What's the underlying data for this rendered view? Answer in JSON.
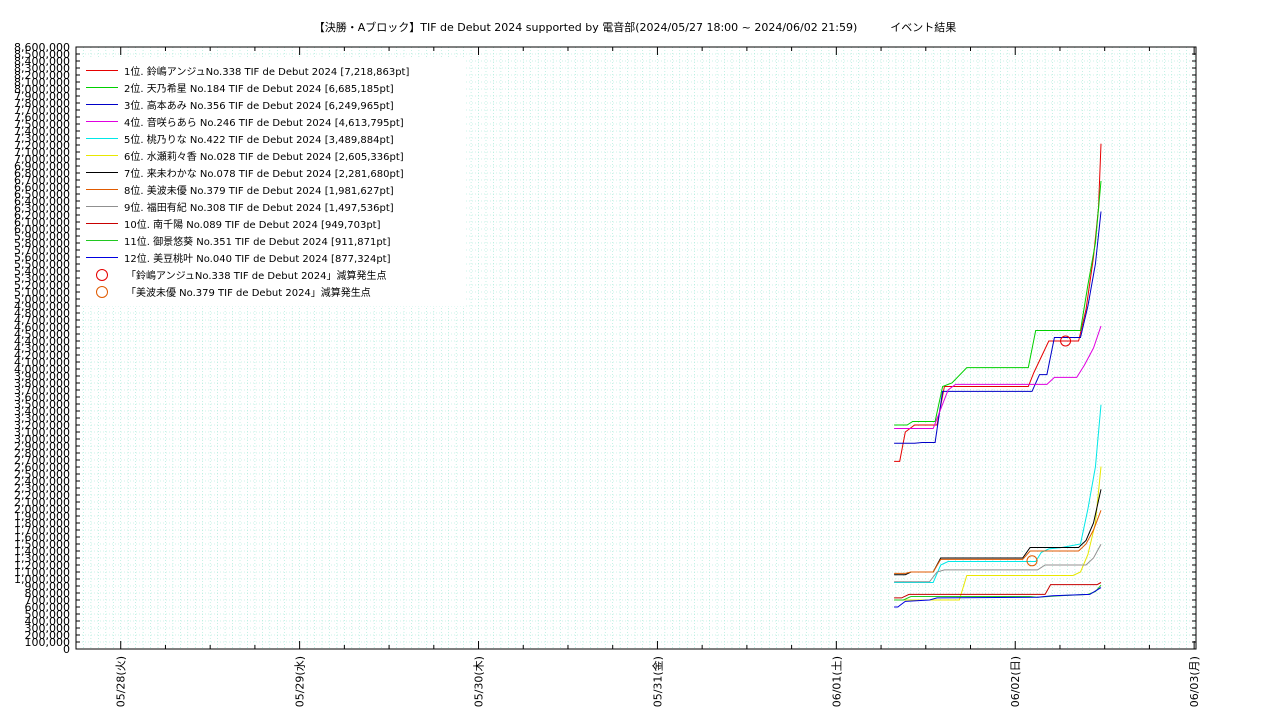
{
  "chart_data": {
    "type": "line",
    "title": "【決勝・Aブロック】TIF de Debut 2024 supported by 電音部(2024/05/27 18:00 ~ 2024/06/02 21:59)　　　イベント結果",
    "xlabel": "",
    "ylabel": "",
    "ylim": [
      0,
      8600000
    ],
    "xlim": [
      "2024-05-27 18:00",
      "2024-06-03 00:15"
    ],
    "y_tick_step": 100000,
    "x_tick_labels": [
      "05/28(火)",
      "05/29(水)",
      "05/30(木)",
      "05/31(金)",
      "06/01(土)",
      "06/02(日)",
      "06/03(月)"
    ],
    "x_tick_dates": [
      "2024-05-28 00:00",
      "2024-05-29 00:00",
      "2024-05-30 00:00",
      "2024-05-31 00:00",
      "2024-06-01 00:00",
      "2024-06-02 00:00",
      "2024-06-03 00:00"
    ],
    "grid": true,
    "legend_position": "top-left",
    "series": [
      {
        "name": "1位. 鈴嶋アンジュNo.338 TIF de Debut 2024 [7,218,863pt]",
        "color": "#e60000",
        "points": [
          [
            "2024-06-01 07:45",
            2680000
          ],
          [
            "2024-06-01 08:30",
            2680000
          ],
          [
            "2024-06-01 09:15",
            3100000
          ],
          [
            "2024-06-01 10:30",
            3200000
          ],
          [
            "2024-06-01 13:30",
            3200000
          ],
          [
            "2024-06-01 14:30",
            3750000
          ],
          [
            "2024-06-02 01:45",
            3750000
          ],
          [
            "2024-06-02 02:30",
            3950000
          ],
          [
            "2024-06-02 04:30",
            4400000
          ],
          [
            "2024-06-02 08:30",
            4400000
          ],
          [
            "2024-06-02 09:30",
            4850000
          ],
          [
            "2024-06-02 10:30",
            5600000
          ],
          [
            "2024-06-02 11:10",
            6300000
          ],
          [
            "2024-06-02 11:30",
            7218863
          ]
        ]
      },
      {
        "name": "2位. 天乃希星 No.184 TIF de Debut 2024 [6,685,185pt]",
        "color": "#00d000",
        "points": [
          [
            "2024-06-01 07:45",
            3200000
          ],
          [
            "2024-06-01 09:30",
            3200000
          ],
          [
            "2024-06-01 10:15",
            3250000
          ],
          [
            "2024-06-01 13:15",
            3250000
          ],
          [
            "2024-06-01 14:15",
            3750000
          ],
          [
            "2024-06-01 15:30",
            3800000
          ],
          [
            "2024-06-01 17:30",
            4020000
          ],
          [
            "2024-06-02 01:45",
            4020000
          ],
          [
            "2024-06-02 02:45",
            4550000
          ],
          [
            "2024-06-02 08:45",
            4550000
          ],
          [
            "2024-06-02 09:45",
            5200000
          ],
          [
            "2024-06-02 10:45",
            5800000
          ],
          [
            "2024-06-02 11:30",
            6685185
          ]
        ]
      },
      {
        "name": "3位. 高本あみ No.356 TIF de Debut 2024 [6,249,965pt]",
        "color": "#0000c8",
        "points": [
          [
            "2024-06-01 07:45",
            2940000
          ],
          [
            "2024-06-01 10:30",
            2940000
          ],
          [
            "2024-06-01 11:30",
            2950000
          ],
          [
            "2024-06-01 13:15",
            2950000
          ],
          [
            "2024-06-01 14:15",
            3680000
          ],
          [
            "2024-06-02 02:15",
            3680000
          ],
          [
            "2024-06-02 03:15",
            3920000
          ],
          [
            "2024-06-02 04:15",
            3920000
          ],
          [
            "2024-06-02 05:15",
            4450000
          ],
          [
            "2024-06-02 08:45",
            4450000
          ],
          [
            "2024-06-02 09:45",
            4900000
          ],
          [
            "2024-06-02 10:45",
            5500000
          ],
          [
            "2024-06-02 11:30",
            6249965
          ]
        ]
      },
      {
        "name": "4位. 音咲らあら No.246 TIF de Debut 2024 [4,613,795pt]",
        "color": "#e000e0",
        "points": [
          [
            "2024-06-01 07:45",
            3150000
          ],
          [
            "2024-06-01 13:00",
            3150000
          ],
          [
            "2024-06-01 15:00",
            3700000
          ],
          [
            "2024-06-01 16:00",
            3780000
          ],
          [
            "2024-06-02 04:15",
            3780000
          ],
          [
            "2024-06-02 05:15",
            3880000
          ],
          [
            "2024-06-02 08:15",
            3880000
          ],
          [
            "2024-06-02 09:15",
            4050000
          ],
          [
            "2024-06-02 10:30",
            4300000
          ],
          [
            "2024-06-02 11:30",
            4613795
          ]
        ]
      },
      {
        "name": "5位. 桃乃りな No.422 TIF de Debut 2024 [3,489,884pt]",
        "color": "#00e8e8",
        "points": [
          [
            "2024-06-01 07:45",
            950000
          ],
          [
            "2024-06-01 13:00",
            950000
          ],
          [
            "2024-06-01 14:00",
            1200000
          ],
          [
            "2024-06-01 15:00",
            1250000
          ],
          [
            "2024-06-02 02:45",
            1250000
          ],
          [
            "2024-06-02 03:30",
            1380000
          ],
          [
            "2024-06-02 04:30",
            1430000
          ],
          [
            "2024-06-02 06:15",
            1450000
          ],
          [
            "2024-06-02 08:45",
            1500000
          ],
          [
            "2024-06-02 09:45",
            2000000
          ],
          [
            "2024-06-02 10:45",
            2600000
          ],
          [
            "2024-06-02 11:30",
            3489884
          ]
        ]
      },
      {
        "name": "6位. 水瀬莉々香 No.028 TIF de Debut 2024 [2,605,336pt]",
        "color": "#e8e800",
        "points": [
          [
            "2024-06-01 07:45",
            700000
          ],
          [
            "2024-06-01 16:30",
            700000
          ],
          [
            "2024-06-01 17:30",
            1050000
          ],
          [
            "2024-06-02 07:45",
            1050000
          ],
          [
            "2024-06-02 08:45",
            1100000
          ],
          [
            "2024-06-02 09:45",
            1350000
          ],
          [
            "2024-06-02 10:45",
            1800000
          ],
          [
            "2024-06-02 11:30",
            2605336
          ]
        ]
      },
      {
        "name": "7位. 来未わかな No.078 TIF de Debut 2024 [2,281,680pt]",
        "color": "#000000",
        "points": [
          [
            "2024-06-01 07:45",
            1060000
          ],
          [
            "2024-06-01 09:15",
            1060000
          ],
          [
            "2024-06-01 10:00",
            1100000
          ],
          [
            "2024-06-01 13:00",
            1100000
          ],
          [
            "2024-06-01 14:00",
            1300000
          ],
          [
            "2024-06-02 01:00",
            1300000
          ],
          [
            "2024-06-02 02:00",
            1450000
          ],
          [
            "2024-06-02 08:30",
            1450000
          ],
          [
            "2024-06-02 09:30",
            1550000
          ],
          [
            "2024-06-02 10:30",
            1800000
          ],
          [
            "2024-06-02 11:30",
            2281680
          ]
        ]
      },
      {
        "name": "8位. 美波未優 No.379 TIF de Debut 2024 [1,981,627pt]",
        "color": "#e05a00",
        "points": [
          [
            "2024-06-01 07:45",
            1080000
          ],
          [
            "2024-06-01 09:15",
            1080000
          ],
          [
            "2024-06-01 10:00",
            1100000
          ],
          [
            "2024-06-01 13:00",
            1100000
          ],
          [
            "2024-06-01 14:00",
            1280000
          ],
          [
            "2024-06-02 01:00",
            1280000
          ],
          [
            "2024-06-02 02:00",
            1400000
          ],
          [
            "2024-06-02 04:00",
            1400000
          ],
          [
            "2024-06-02 05:00",
            1400000
          ],
          [
            "2024-06-02 08:30",
            1400000
          ],
          [
            "2024-06-02 09:30",
            1500000
          ],
          [
            "2024-06-02 10:30",
            1700000
          ],
          [
            "2024-06-02 11:30",
            1981627
          ]
        ]
      },
      {
        "name": "9位. 福田有紀 No.308 TIF de Debut 2024 [1,497,536pt]",
        "color": "#909090",
        "points": [
          [
            "2024-06-01 07:45",
            960000
          ],
          [
            "2024-06-01 12:30",
            960000
          ],
          [
            "2024-06-01 13:30",
            1100000
          ],
          [
            "2024-06-01 14:30",
            1130000
          ],
          [
            "2024-06-02 03:00",
            1130000
          ],
          [
            "2024-06-02 04:00",
            1200000
          ],
          [
            "2024-06-02 09:30",
            1200000
          ],
          [
            "2024-06-02 10:30",
            1300000
          ],
          [
            "2024-06-02 11:30",
            1497536
          ]
        ]
      },
      {
        "name": "10位. 南千陽 No.089 TIF de Debut 2024 [949,703pt]",
        "color": "#c80000",
        "points": [
          [
            "2024-06-01 07:45",
            730000
          ],
          [
            "2024-06-01 08:45",
            730000
          ],
          [
            "2024-06-01 09:45",
            780000
          ],
          [
            "2024-06-02 04:00",
            780000
          ],
          [
            "2024-06-02 04:45",
            920000
          ],
          [
            "2024-06-02 11:00",
            920000
          ],
          [
            "2024-06-02 11:30",
            949703
          ]
        ]
      },
      {
        "name": "11位. 御景悠葵 No.351 TIF de Debut 2024 [911,871pt]",
        "color": "#20c820",
        "points": [
          [
            "2024-06-01 07:45",
            700000
          ],
          [
            "2024-06-01 09:00",
            700000
          ],
          [
            "2024-06-01 10:00",
            750000
          ],
          [
            "2024-06-02 02:00",
            750000
          ],
          [
            "2024-06-02 03:00",
            740000
          ],
          [
            "2024-06-02 06:00",
            760000
          ],
          [
            "2024-06-02 09:45",
            780000
          ],
          [
            "2024-06-02 10:45",
            820000
          ],
          [
            "2024-06-02 11:30",
            911871
          ]
        ]
      },
      {
        "name": "12位. 美豆桃叶 No.040 TIF de Debut 2024 [877,324pt]",
        "color": "#0000e0",
        "points": [
          [
            "2024-06-01 07:45",
            600000
          ],
          [
            "2024-06-01 08:15",
            600000
          ],
          [
            "2024-06-01 09:15",
            680000
          ],
          [
            "2024-06-01 12:30",
            700000
          ],
          [
            "2024-06-01 13:30",
            730000
          ],
          [
            "2024-06-02 03:00",
            740000
          ],
          [
            "2024-06-02 05:00",
            760000
          ],
          [
            "2024-06-02 10:00",
            780000
          ],
          [
            "2024-06-02 11:30",
            877324
          ]
        ]
      }
    ],
    "markers": [
      {
        "name": "「鈴嶋アンジュNo.338 TIF de Debut 2024」減算発生点",
        "color": "#e60000",
        "x": "2024-06-02 06:45",
        "y": 4400000
      },
      {
        "name": "「美波未優 No.379 TIF de Debut 2024」減算発生点",
        "color": "#e05a00",
        "x": "2024-06-02 02:15",
        "y": 1260000
      }
    ]
  }
}
